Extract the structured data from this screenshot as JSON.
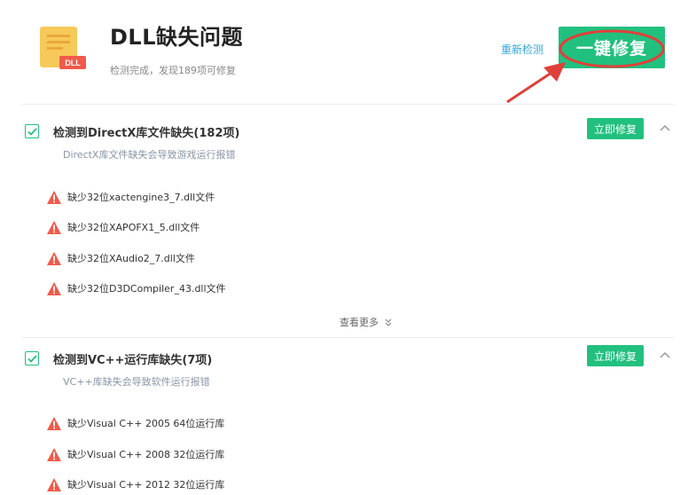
{
  "header": {
    "icon_text": "DLL",
    "title": "DLL缺失问题",
    "subtitle": "检测完成，发现189项可修复",
    "rescan_label": "重新检测",
    "fix_all_label": "一键修复"
  },
  "colors": {
    "accent_green": "#22c07f",
    "link_blue": "#33a6d8",
    "warning_red": "#f05a4a",
    "annotation_red": "#e0403a"
  },
  "sections": [
    {
      "title": "检测到DirectX库文件缺失(182项)",
      "subtitle": "DirectX库文件缺失会导致游戏运行报错",
      "fix_label": "立即修复",
      "checked": true,
      "items": [
        "缺少32位xactengine3_7.dll文件",
        "缺少32位XAPOFX1_5.dll文件",
        "缺少32位XAudio2_7.dll文件",
        "缺少32位D3DCompiler_43.dll文件"
      ],
      "more_label": "查看更多"
    },
    {
      "title": "检测到VC++运行库缺失(7项)",
      "subtitle": "VC++库缺失会导致软件运行报错",
      "fix_label": "立即修复",
      "checked": true,
      "items": [
        "缺少Visual C++ 2005 64位运行库",
        "缺少Visual C++ 2008 32位运行库",
        "缺少Visual C++ 2012 32位运行库"
      ]
    }
  ]
}
